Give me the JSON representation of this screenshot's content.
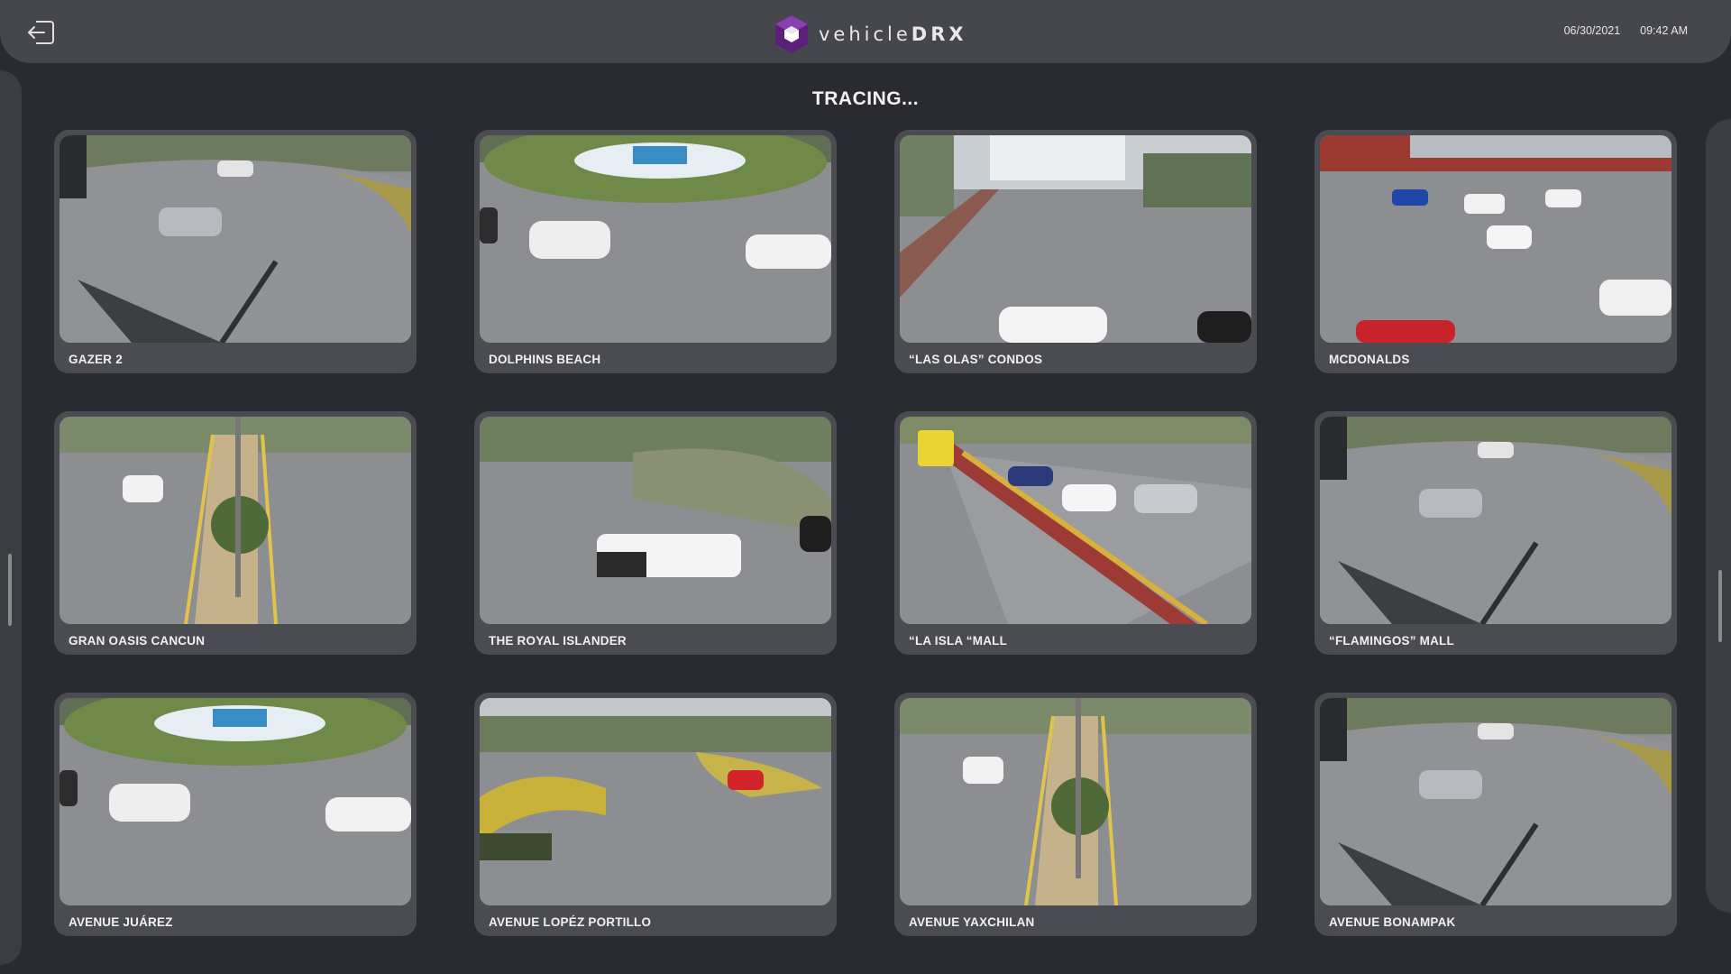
{
  "header": {
    "brand_light": "vehicle",
    "brand_bold": "DRX",
    "date": "06/30/2021",
    "time": "09:42 AM"
  },
  "page": {
    "title": "TRACING..."
  },
  "colors": {
    "accent": "#6a2b8a",
    "card": "#4b4c51",
    "background": "#2a2b30",
    "topbar": "#46474c",
    "detection_box": "#3bdc4a"
  },
  "icons": {
    "back": "logout-arrow-icon",
    "logo": "hexagon-cube-icon"
  },
  "cameras": [
    {
      "label": "GAZER 2",
      "scene": "roundabout-corner"
    },
    {
      "label": "DOLPHINS BEACH",
      "scene": "fountain"
    },
    {
      "label": "“LAS OLAS” CONDOS",
      "scene": "buildings"
    },
    {
      "label": "MCDONALDS",
      "scene": "busy-street"
    },
    {
      "label": "GRAN OASIS CANCUN",
      "scene": "boulevard"
    },
    {
      "label": "THE ROYAL ISLANDER",
      "scene": "roundabout-truck"
    },
    {
      "label": "“LA ISLA “MALL",
      "scene": "traffic"
    },
    {
      "label": "“FLAMINGOS” MALL",
      "scene": "roundabout-corner"
    },
    {
      "label": "AVENUE JUÁREZ",
      "scene": "fountain"
    },
    {
      "label": "AVENUE LOPÉZ PORTILLO",
      "scene": "intersection"
    },
    {
      "label": "AVENUE YAXCHILAN",
      "scene": "boulevard"
    },
    {
      "label": "AVENUE BONAMPAK",
      "scene": "roundabout-corner"
    }
  ]
}
